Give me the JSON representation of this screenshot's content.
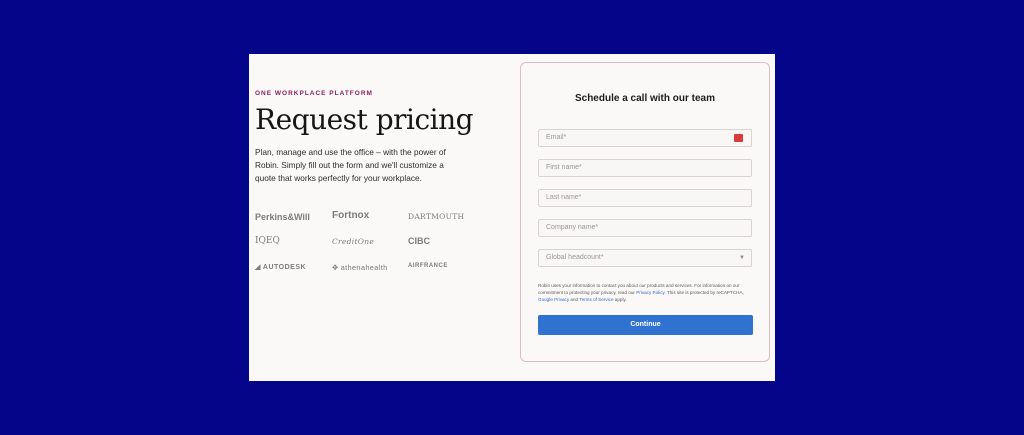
{
  "left": {
    "eyebrow": "ONE WORKPLACE PLATFORM",
    "headline": "Request pricing",
    "description": "Plan, manage and use the office – with the power of Robin. Simply fill out the form and we'll customize a quote that works perfectly for your workplace.",
    "logos": [
      "Perkins&Will",
      "Fortnox",
      "DARTMOUTH",
      "IQEQ",
      "CreditOne",
      "CIBC",
      "AUTODESK",
      "athenahealth",
      "AIRFRANCE"
    ]
  },
  "form": {
    "title": "Schedule a call with our team",
    "email_placeholder": "Email*",
    "first_name_placeholder": "First name*",
    "last_name_placeholder": "Last name*",
    "company_placeholder": "Company name*",
    "headcount_placeholder": "Global headcount*",
    "consent": {
      "text1": "Robin uses your information to contact you about our products and services. For information on our commitment to protecting your privacy, read our ",
      "privacy_link": "Privacy Policy",
      "text2": ". This site is protected by reCAPTCHA, ",
      "google_privacy_link": "Google Privacy",
      "text3": " and ",
      "terms_link": "Terms of Service",
      "text4": " apply."
    },
    "continue_label": "Continue"
  },
  "colors": {
    "background": "#05058a",
    "card": "#fbf9f7",
    "eyebrow": "#8e1f5c",
    "button": "#2f72cf",
    "panel_border": "#e4b9c6"
  }
}
